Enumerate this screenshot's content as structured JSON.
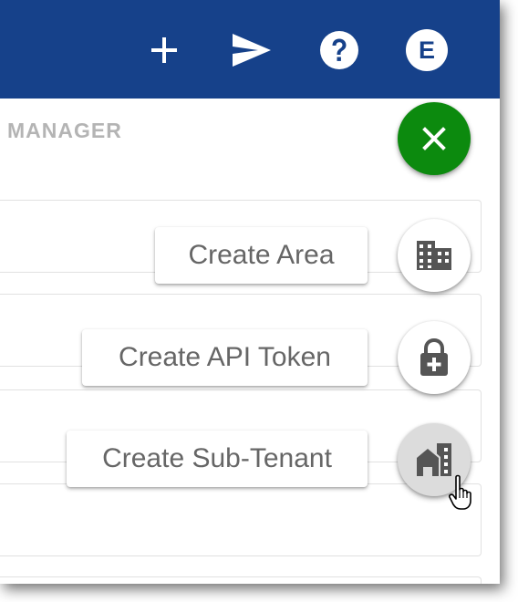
{
  "colors": {
    "header_bg": "#16418a",
    "fab_close_bg": "#0c8a0e",
    "fab_mini_bg": "#ffffff",
    "fab_hover_bg": "#dcdcdc",
    "section_title": "#777777",
    "icon_gray": "#555555"
  },
  "header": {
    "icons": [
      "plus-icon",
      "send-icon",
      "help-icon",
      "avatar"
    ],
    "avatar_letter": "E"
  },
  "section": {
    "title": "MANAGER"
  },
  "speed_dial": {
    "close_icon": "close-icon",
    "actions": [
      {
        "label": "Create Area",
        "icon": "building-icon"
      },
      {
        "label": "Create API Token",
        "icon": "lock-plus-icon"
      },
      {
        "label": "Create Sub-Tenant",
        "icon": "home-building-icon"
      }
    ]
  }
}
